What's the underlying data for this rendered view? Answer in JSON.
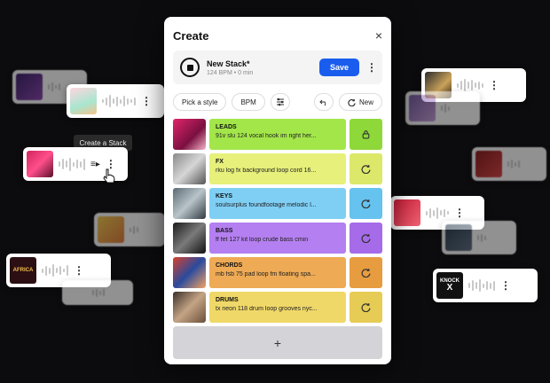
{
  "tooltip": "Create a Stack",
  "dialog": {
    "title": "Create",
    "stack_name": "New Stack*",
    "stack_meta": "124 BPM • 0 min",
    "save_label": "Save",
    "style_label": "Pick a style",
    "bpm_label": "BPM",
    "new_label": "New"
  },
  "rows": [
    {
      "category": "LEADS",
      "sample": "91v slu 124 vocal hook im right her...",
      "action": "lock-icon",
      "color": "#a3e64a",
      "action_color": "#8ed83a"
    },
    {
      "category": "FX",
      "sample": "rku log fx background loop cord 16...",
      "action": "refresh-icon",
      "color": "#e6f07a",
      "action_color": "#dbe86a"
    },
    {
      "category": "KEYS",
      "sample": "soulsurplus foundfootage melodic l...",
      "action": "refresh-icon",
      "color": "#7fcff5",
      "action_color": "#66c2ef"
    },
    {
      "category": "BASS",
      "sample": "ff fet 127 kit loop crude bass cmin",
      "action": "refresh-icon",
      "color": "#b47ff0",
      "action_color": "#a56be8"
    },
    {
      "category": "CHORDS",
      "sample": "mb fsb 75 pad loop fm floating spa...",
      "action": "refresh-icon",
      "color": "#eeaa55",
      "action_color": "#e79c40"
    },
    {
      "category": "DRUMS",
      "sample": "tx neon 118 drum loop grooves nyc...",
      "action": "refresh-icon",
      "color": "#f0d868",
      "action_color": "#e6cc55"
    }
  ],
  "add_label": "+",
  "close_glyph": "×",
  "kebab": "⋮",
  "knock_text": "KNOCK",
  "knock_x": "X",
  "africa_text": "AFRICA"
}
